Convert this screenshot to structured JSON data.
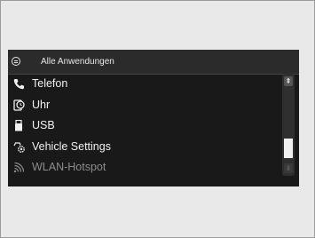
{
  "header": {
    "title": "Alle Anwendungen",
    "icon": "apps-menu-icon"
  },
  "items": [
    {
      "label": "Telefon",
      "icon": "phone-icon",
      "enabled": true
    },
    {
      "label": "Uhr",
      "icon": "clock-icon",
      "enabled": true
    },
    {
      "label": "USB",
      "icon": "usb-icon",
      "enabled": true
    },
    {
      "label": "Vehicle Settings",
      "icon": "car-settings-icon",
      "enabled": true
    },
    {
      "label": "WLAN-Hotspot",
      "icon": "wifi-hotspot-icon",
      "enabled": false
    }
  ],
  "scrollbar": {
    "up_symbol": "⇞",
    "down_symbol": "⇟",
    "position": 0.75
  },
  "colors": {
    "background": "#191919",
    "text": "#f2f2f2",
    "disabled_text": "#8c8c8c"
  }
}
